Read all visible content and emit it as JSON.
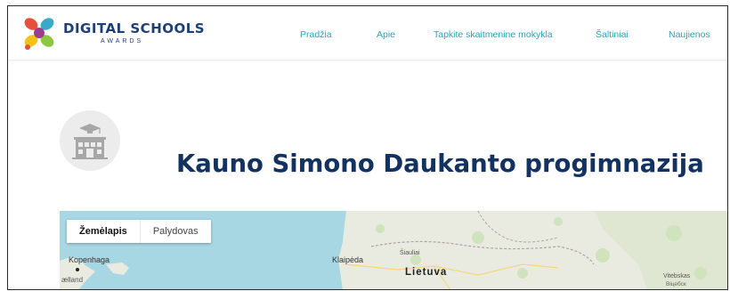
{
  "header": {
    "logo_title": "DIGITAL SCHOOLS",
    "logo_subtitle": "AWARDS",
    "nav": [
      {
        "label": "Pradžia"
      },
      {
        "label": "Apie"
      },
      {
        "label": "Tapkite skaitmenine mokykla"
      },
      {
        "label": "Šaltiniai"
      },
      {
        "label": "Naujienos"
      }
    ]
  },
  "school": {
    "name": "Kauno Simono Daukanto progimnazija",
    "avatar_icon": "school-building-icon"
  },
  "map": {
    "map_type_button": "Žemėlapis",
    "satellite_button": "Palydovas",
    "labels": {
      "kopenhaga": "Kopenhaga",
      "zealand": "ælland",
      "klaipeda": "Klaipėda",
      "siauliai": "Šiauliai",
      "lietuva": "Lietuva",
      "vitebskas": "Vitebskas",
      "viciebsk": "Віцебск"
    }
  },
  "colors": {
    "nav_link": "#2aa4b8",
    "logo_text": "#1d3f78",
    "school_title": "#13325f",
    "water": "#a8d7e4",
    "land": "#e9ebe1"
  }
}
